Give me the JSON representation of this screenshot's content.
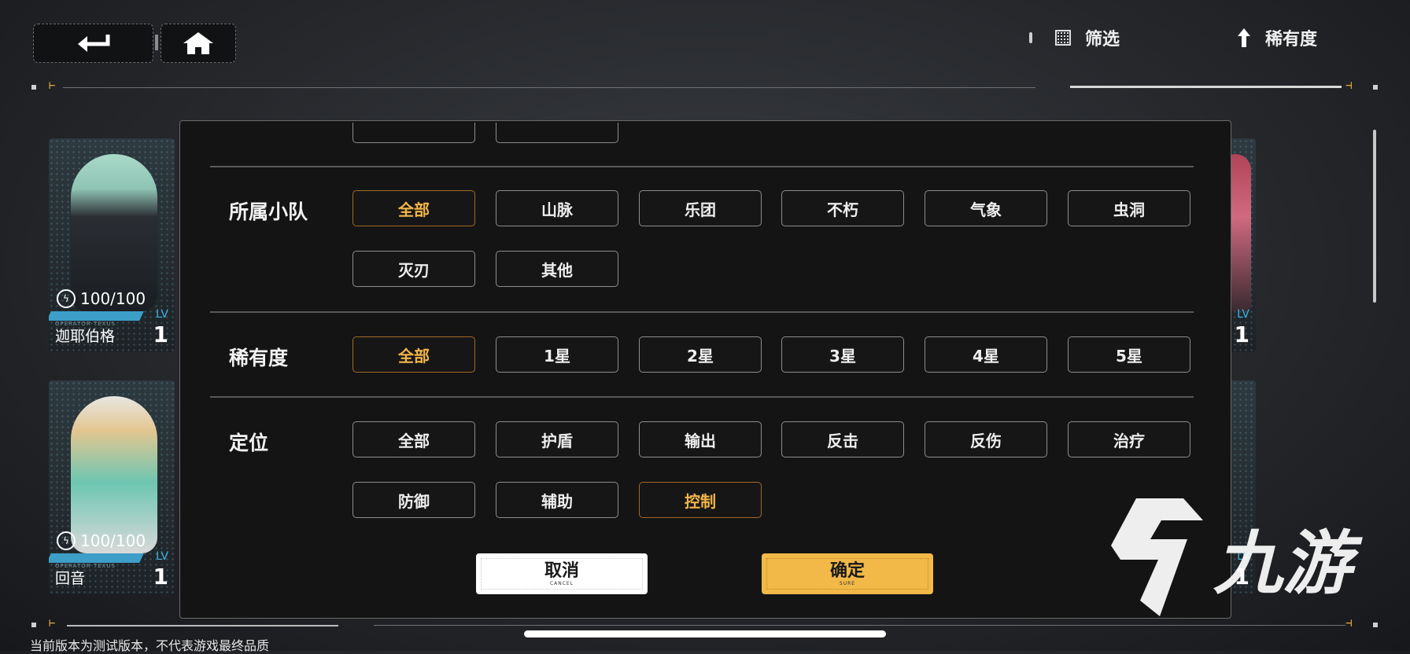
{
  "header": {
    "back_icon": "back-arrow-icon",
    "home_icon": "home-icon",
    "filter_label": "筛选",
    "sort_label": "稀有度"
  },
  "cards": [
    {
      "name": "迦耶伯格",
      "stamina": "100/100",
      "operator_tag": "OPERATOR·TEXUS",
      "lv_label": "LV",
      "level": "1"
    },
    {
      "name": "回音",
      "stamina": "100/100",
      "operator_tag": "OPERATOR·TEXUS",
      "lv_label": "LV",
      "level": "1"
    }
  ],
  "filter_modal": {
    "squad": {
      "title": "所属小队",
      "options": [
        "全部",
        "山脉",
        "乐团",
        "不朽",
        "气象",
        "虫洞",
        "灭刃",
        "其他"
      ],
      "selected": "全部"
    },
    "rarity": {
      "title": "稀有度",
      "options": [
        "全部",
        "1星",
        "2星",
        "3星",
        "4星",
        "5星"
      ],
      "selected": "全部"
    },
    "position": {
      "title": "定位",
      "options": [
        "全部",
        "护盾",
        "输出",
        "反击",
        "反伤",
        "治疗",
        "防御",
        "辅助",
        "控制"
      ],
      "selected": "控制"
    },
    "cancel": {
      "label": "取消",
      "sub": "CANCEL"
    },
    "confirm": {
      "label": "确定",
      "sub": "SURE"
    }
  },
  "watermark": "九游",
  "footer_notice": "当前版本为测试版本，不代表游戏最终品质",
  "colors": {
    "accent": "#f3b54a",
    "confirm_bg": "#f2b948",
    "lv_blue": "#3db4e6"
  }
}
